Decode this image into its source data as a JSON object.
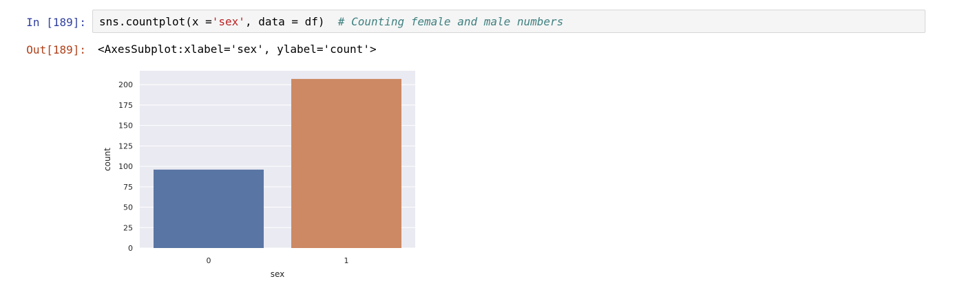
{
  "cell": {
    "in_prompt": "In [189]:",
    "out_prompt": "Out[189]:",
    "code": {
      "prefix": "sns.countplot(x =",
      "string": "'sex'",
      "middle": ", data = df)  ",
      "comment": "# Counting female and male numbers"
    },
    "output_text": "<AxesSubplot:xlabel='sex', ylabel='count'>"
  },
  "colors": {
    "in_prompt": "#303f9f",
    "out_prompt": "#b0401a",
    "axes_background": "#eaeaf2",
    "grid": "#ffffff",
    "bar_0": "#5975a4",
    "bar_1": "#cc8963"
  },
  "chart_data": {
    "type": "bar",
    "categories": [
      "0",
      "1"
    ],
    "values": [
      96,
      207
    ],
    "xlabel": "sex",
    "ylabel": "count",
    "ylim": [
      0,
      217
    ],
    "yticks": [
      0,
      25,
      50,
      75,
      100,
      125,
      150,
      175,
      200
    ],
    "grid": true
  }
}
